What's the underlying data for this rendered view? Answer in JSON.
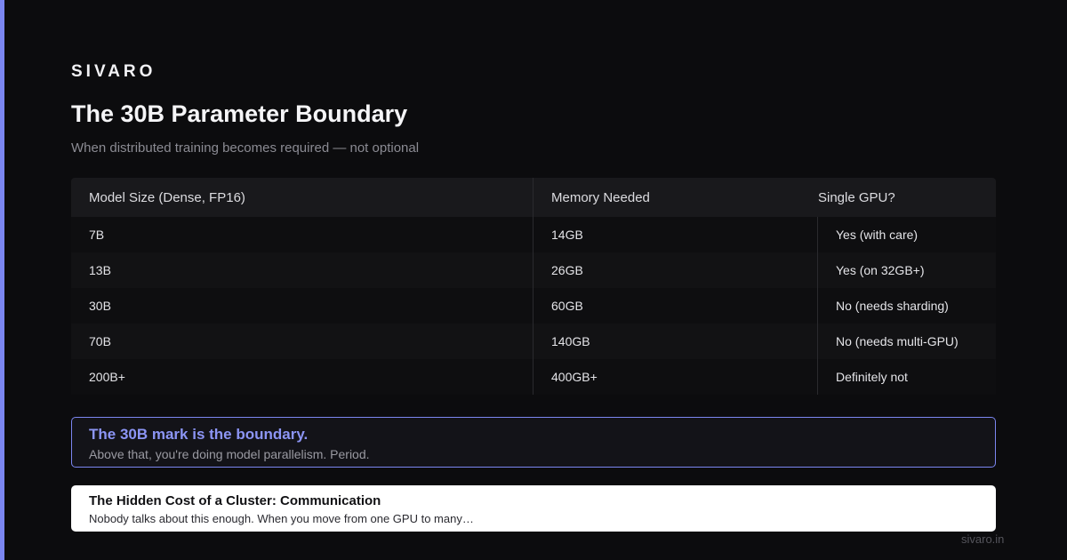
{
  "brand": "SIVARO",
  "title": "The 30B Parameter Boundary",
  "subtitle": "When distributed training becomes required — not optional",
  "table": {
    "headers": [
      "Model Size (Dense, FP16)",
      "Memory Needed",
      "Single GPU?"
    ],
    "rows": [
      [
        "7B",
        "14GB",
        "Yes (with care)"
      ],
      [
        "13B",
        "26GB",
        "Yes (on 32GB+)"
      ],
      [
        "30B",
        "60GB",
        "No (needs sharding)"
      ],
      [
        "70B",
        "140GB",
        "No (needs multi-GPU)"
      ],
      [
        "200B+",
        "400GB+",
        "Definitely not"
      ]
    ]
  },
  "callout": {
    "title": "The 30B mark is the boundary.",
    "text": "Above that, you're doing model parallelism. Period."
  },
  "card": {
    "title": "The Hidden Cost of a Cluster: Communication",
    "text": "Nobody talks about this enough. When you move from one GPU to many…"
  },
  "footer": "sivaro.in",
  "colors": {
    "accent": "#7b86f0",
    "background": "#0c0c0e",
    "card": "#ffffff"
  }
}
